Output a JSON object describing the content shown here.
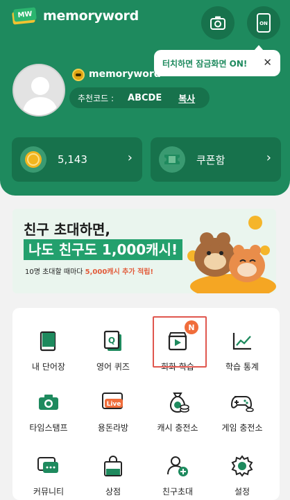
{
  "header": {
    "app_name": "memoryword",
    "logo_mark": "MW",
    "camera_icon": "camera-icon",
    "lock_icon_label": "ON",
    "tooltip_text": "터치하면 잠금화면 ON!",
    "tooltip_close": "✕"
  },
  "profile": {
    "nickname": "memoryword",
    "referral_label": "추천코드 :",
    "referral_code": "ABCDE",
    "copy_label": "복사"
  },
  "stats": {
    "coins": "5,143",
    "coupon_label": "쿠폰함",
    "arrow": "›"
  },
  "banner": {
    "line1": "친구 초대하면,",
    "line2": "나도 친구도 1,000캐시!",
    "line3_pre": "10명 초대할 때마다 ",
    "line3_hl": "5,000캐시 추가 적립!"
  },
  "menu": {
    "items": [
      {
        "label": "내 단어장",
        "icon": "book-icon"
      },
      {
        "label": "영어 퀴즈",
        "icon": "quiz-card-icon"
      },
      {
        "label": "회화 학습",
        "icon": "video-lesson-icon"
      },
      {
        "label": "학습 통계",
        "icon": "chart-icon"
      },
      {
        "label": "타임스탬프",
        "icon": "camera-icon"
      },
      {
        "label": "용돈라방",
        "icon": "live-tv-icon"
      },
      {
        "label": "캐시 충전소",
        "icon": "money-bag-icon"
      },
      {
        "label": "게임 충전소",
        "icon": "gamepad-icon"
      },
      {
        "label": "커뮤니티",
        "icon": "chat-icon"
      },
      {
        "label": "상점",
        "icon": "shopping-bag-icon"
      },
      {
        "label": "친구초대",
        "icon": "add-friend-icon"
      },
      {
        "label": "설정",
        "icon": "gear-icon"
      }
    ],
    "new_badge": "N",
    "live_label": "Live",
    "quiz_letter": "Q"
  },
  "colors": {
    "brand_green": "#1e8a5e",
    "dark_green": "#17724c",
    "highlight_red": "#e0564e",
    "badge_orange": "#f06d3b"
  }
}
